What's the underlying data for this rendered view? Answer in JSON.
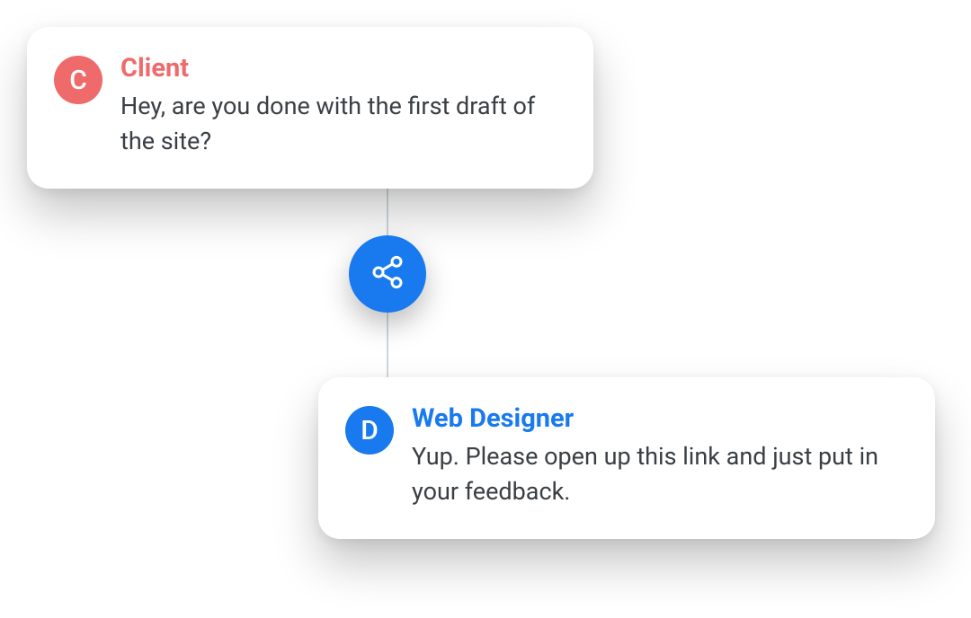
{
  "colors": {
    "accent_blue": "#1979ef",
    "accent_coral": "#ef6b6b"
  },
  "share_icon_name": "share-icon",
  "cards": {
    "client": {
      "avatar_letter": "C",
      "avatar_bg": "#ef6b6b",
      "title": "Client",
      "title_color": "#ef6b6b",
      "message": "Hey, are you done with the first draft of the site?"
    },
    "designer": {
      "avatar_letter": "D",
      "avatar_bg": "#1979ef",
      "title": "Web Designer",
      "title_color": "#1979ef",
      "message": "Yup. Please open up this link and just put in your feedback."
    }
  }
}
